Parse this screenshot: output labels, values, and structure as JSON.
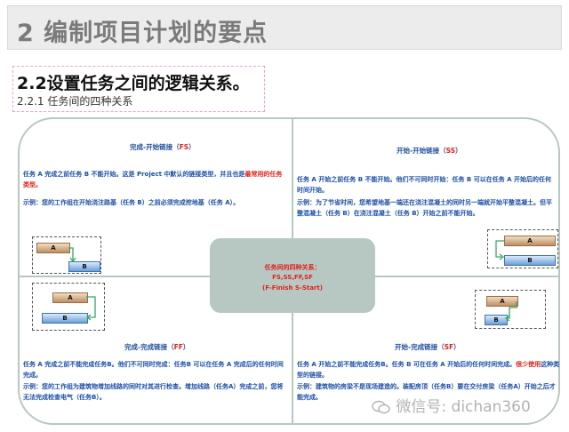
{
  "header": {
    "title": "2 编制项目计划的要点"
  },
  "section": {
    "title": "2.2设置任务之间的逻辑关系。",
    "subtitle": "2.2.1 任务间的四种关系"
  },
  "center": {
    "line1": "任务间的四种关系：",
    "line2": "FS,SS,FF,SF",
    "line3": "(F-Finish S-Start)"
  },
  "quadrants": {
    "fs": {
      "title_main": "完成-开始链接（",
      "title_code": "FS",
      "title_end": "）",
      "text1_main": "任务 A 完成之前任务 B 不能开始。这是 Project 中默认的链接类型，并且也是",
      "text1_red": "最常用的任务类型。",
      "text2": "示例：您的工作组在开始浇注路基（任务 B）之前必须完成挖地基（任务 A）。",
      "bar_a": "A",
      "bar_b": "B"
    },
    "ss": {
      "title_main": "开始-开始链接（",
      "title_code": "SS",
      "title_end": "）",
      "text1": "任务 A 开始之前任务 B 不能开始。他们不可同时开始：任务 B 可以在任务 A 开始后的任何时间开始。",
      "text2": "示例：为了节省时间，您希望地基一端还在浇注混凝土的同时另一端就开始平整混凝土。但平整混凝土（任务 B）在浇注混凝土（任务 B）开始之前不能开始。",
      "bar_a": "A",
      "bar_b": "B"
    },
    "ff": {
      "title_main": "完成-完成链接（",
      "title_code": "FF",
      "title_end": "）",
      "text1": "任务 A 完成之前不能完成任务B。他们不可同时完成：任务B 可以在任务 A 完成后的任何时间完成。",
      "text2": "示例：您的工作组为建筑物增加线路的同时对其进行检查。增加线路（任务A）完成之前，您将无法完成检查电气（任务B）。",
      "bar_a": "A",
      "bar_b": "B"
    },
    "sf": {
      "title_main": "开始-完成链接（",
      "title_code": "SF",
      "title_end": "）",
      "text1_main": "任务 A 开始之前不能完成任务B。任务 B 可在任务 A 开始后的任何时间完成。",
      "text1_red": "很少使用",
      "text1_end": "这种类型的链接。",
      "text2": "示例：建筑物的房梁不是现场建造的。装配房顶（任务B）要在交付房梁（任务A）开始之后才能完成。",
      "bar_a": "A",
      "bar_b": "B"
    }
  },
  "watermark": {
    "text": "微信号: dichan360"
  }
}
